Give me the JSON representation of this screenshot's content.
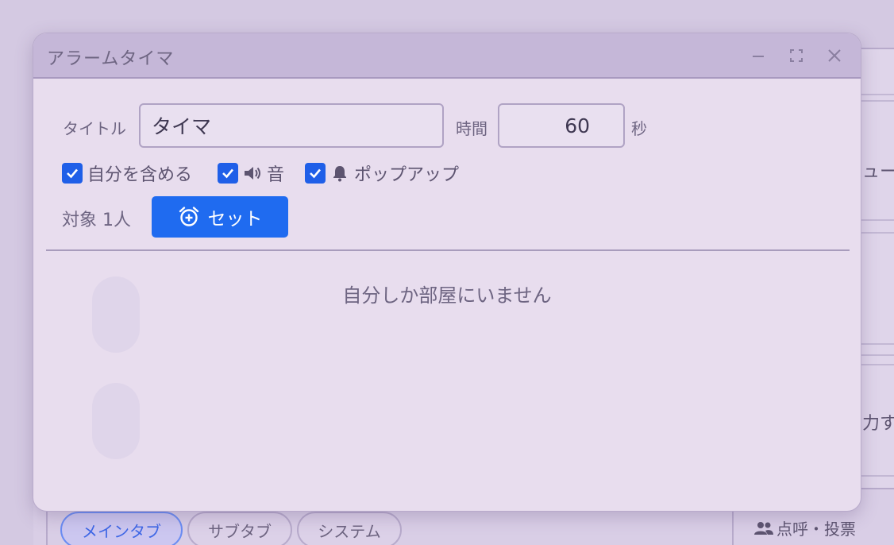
{
  "background": {
    "right_text_top": "ュー",
    "right_text_bottom": "力す",
    "tabs": [
      {
        "label": "メインタブ",
        "active": true
      },
      {
        "label": "サブタブ",
        "active": false
      },
      {
        "label": "システム",
        "active": false
      }
    ],
    "rollcall_label": "点呼・投票"
  },
  "dialog": {
    "title": "アラームタイマ",
    "controls": {
      "minimize_icon": "minimize-icon",
      "maximize_icon": "fullscreen-icon",
      "close_icon": "close-icon"
    },
    "title_label": "タイトル",
    "title_value": "タイマ",
    "time_label": "時間",
    "time_value": "60",
    "time_unit": "秒",
    "options": {
      "include_self": {
        "label": "自分を含める",
        "checked": true
      },
      "sound": {
        "label": "音",
        "checked": true,
        "icon": "volume-icon"
      },
      "popup": {
        "label": "ポップアップ",
        "checked": true,
        "icon": "bell-icon"
      }
    },
    "target_label": "対象 1人",
    "set_button_label": "セット",
    "set_button_icon": "alarm-add-icon",
    "empty_message": "自分しか部屋にいません"
  },
  "colors": {
    "accent": "#1f6bf0",
    "header": "#c5b7d8",
    "dialog_bg": "#e8ddee"
  }
}
